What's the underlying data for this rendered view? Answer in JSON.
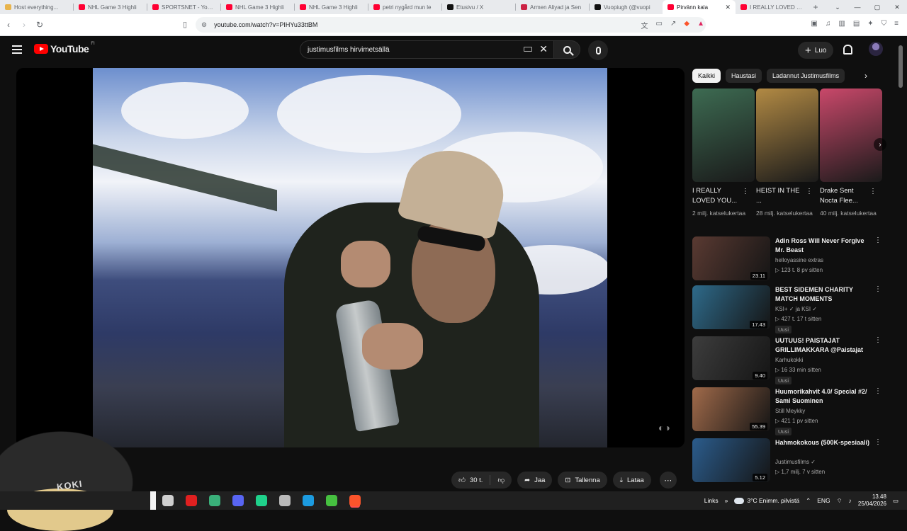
{
  "browser": {
    "tabs": [
      {
        "title": "Host everything...",
        "color": "#e8b44c",
        "active": false
      },
      {
        "title": "NHL Game 3 Highli",
        "color": "#ff0033",
        "active": false
      },
      {
        "title": "SPORTSNET - YouTu",
        "color": "#ff0033",
        "active": false
      },
      {
        "title": "NHL Game 3 Highli",
        "color": "#ff0033",
        "active": false
      },
      {
        "title": "NHL Game 3 Highli",
        "color": "#ff0033",
        "active": false
      },
      {
        "title": "petri nygård mun le",
        "color": "#ff0033",
        "active": false
      },
      {
        "title": "Etusivu / X",
        "color": "#111111",
        "active": false
      },
      {
        "title": "Armen Aliyad ja Sen",
        "color": "#cc2244",
        "active": false
      },
      {
        "title": "Vuopiugh (@vuopi",
        "color": "#111111",
        "active": false
      },
      {
        "title": "Pirvänn kala",
        "color": "#ff0033",
        "active": true
      },
      {
        "title": "I REALLY LOVED YO",
        "color": "#ff0033",
        "active": false
      }
    ],
    "new_tab": "+",
    "url": "youtube.com/watch?v=PIHYu33ttBM"
  },
  "youtube": {
    "logo": "YouTube",
    "country": "FI",
    "search_value": "justimusfilms hirvimetsällä",
    "create_label": "Luo"
  },
  "actions": {
    "like_count": "30 t.",
    "share": "Jaa",
    "save": "Tallenna",
    "download": "Lataa"
  },
  "chips": [
    "Kaikki",
    "Haustasi",
    "Ladannut Justimusfilms"
  ],
  "shorts": [
    {
      "title": "I REALLY LOVED YOU...",
      "views": "2 milj. katselukertaa",
      "color": "#3d6b52"
    },
    {
      "title": "HEIST IN THE ...",
      "views": "28 milj. katselukertaa",
      "color": "#b28a44"
    },
    {
      "title": "Drake Sent Nocta Flee...",
      "views": "40 milj. katselukertaa",
      "color": "#c9486a"
    }
  ],
  "recommendations": [
    {
      "title": "Adin Ross Will Never Forgive Mr. Beast",
      "channel": "helloyassine extras",
      "meta": "▷ 123 t.   8 pv sitten",
      "duration": "23.11",
      "badge": "",
      "color": "#5a3a32"
    },
    {
      "title": "BEST SIDEMEN CHARITY MATCH MOMENTS",
      "channel": "KSI+ ✓ ja KSI ✓",
      "meta": "▷ 427 t.   17 t sitten",
      "duration": "17.43",
      "badge": "Uusi",
      "color": "#2e6a8a"
    },
    {
      "title": "UUTUUS! PAISTAJAT GRILLIMAKKARA @Paistajat",
      "channel": "Karhukokki",
      "meta": "▷ 16   33 min sitten",
      "duration": "9.40",
      "badge": "Uusi",
      "color": "#3d3d3d"
    },
    {
      "title": "Huumorikahvit 4.0/ Special #2/ Sami Suominen",
      "channel": "Still Meykky",
      "meta": "▷ 421   1 pv sitten",
      "duration": "55.39",
      "badge": "Uusi",
      "color": "#a06a4a"
    },
    {
      "title": "Hahmokokous (500K-spesiaali)",
      "channel": "Justimusfilms ✓",
      "meta": "▷ 1,7 milj.   7 v sitten",
      "duration": "5.12",
      "badge": "",
      "color": "#2b5c8c"
    }
  ],
  "taskbar": {
    "links": "Links",
    "weather": "3°C  Enimm. pilvistä",
    "lang": "ENG",
    "time": "13.48",
    "date": "25/04/2026",
    "apps": [
      {
        "name": "task-view",
        "color": "#cfcfcf"
      },
      {
        "name": "opera",
        "color": "#e02020"
      },
      {
        "name": "app-green",
        "color": "#3ab07a"
      },
      {
        "name": "discord",
        "color": "#5865f2"
      },
      {
        "name": "spotify-like",
        "color": "#1fd18b"
      },
      {
        "name": "shield",
        "color": "#b9b9b9"
      },
      {
        "name": "edge",
        "color": "#1c9be0"
      },
      {
        "name": "play",
        "color": "#46c040"
      },
      {
        "name": "brave",
        "color": "#fb542b"
      }
    ]
  },
  "webcam": {
    "logo": "KOKI"
  }
}
